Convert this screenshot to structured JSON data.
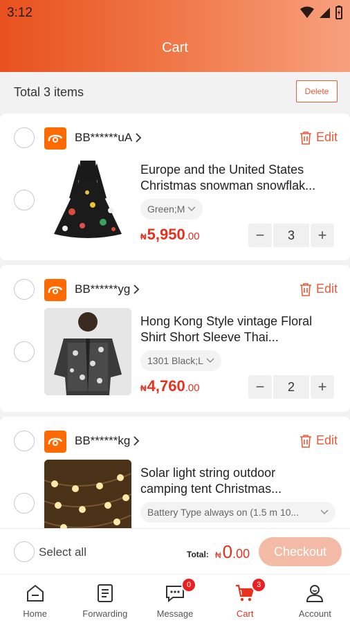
{
  "status_bar": {
    "time": "3:12"
  },
  "header": {
    "title": "Cart"
  },
  "summary": {
    "total_text": "Total 3 items",
    "delete_label": "Delete"
  },
  "items": [
    {
      "shop_name": "BB******uA",
      "edit_label": "Edit",
      "title_line1": "Europe and the United States",
      "title_line2": "Christmas snowman snowflak...",
      "variant": "Green;M",
      "currency": "₦",
      "price_int": "5,950",
      "price_dec": ".00",
      "quantity": "3"
    },
    {
      "shop_name": "BB******yg",
      "edit_label": "Edit",
      "title_line1": "Hong Kong Style vintage Floral",
      "title_line2": "Shirt Short Sleeve Thai...",
      "variant": "1301 Black;L",
      "currency": "₦",
      "price_int": "4,760",
      "price_dec": ".00",
      "quantity": "2"
    },
    {
      "shop_name": "BB******kg",
      "edit_label": "Edit",
      "title_line1": "Solar light string outdoor",
      "title_line2": "camping tent Christmas...",
      "variant": "Battery Type always on (1.5 m 10..."
    }
  ],
  "checkout": {
    "select_all_label": "Select all",
    "total_label": "Total:",
    "currency": "₦",
    "total_int": "0",
    "total_dec": ".00",
    "checkout_label": "Checkout"
  },
  "tabbar": {
    "tabs": [
      {
        "label": "Home",
        "icon": "home-icon"
      },
      {
        "label": "Forwarding",
        "icon": "document-icon"
      },
      {
        "label": "Message",
        "icon": "message-icon",
        "badge": "0"
      },
      {
        "label": "Cart",
        "icon": "cart-icon",
        "badge": "3",
        "active": true
      },
      {
        "label": "Account",
        "icon": "account-icon"
      }
    ]
  },
  "colors": {
    "accent": "#e8301f",
    "header_start": "#e8511f",
    "header_end": "#f7a07e",
    "checkout_disabled": "#f3bba6"
  }
}
